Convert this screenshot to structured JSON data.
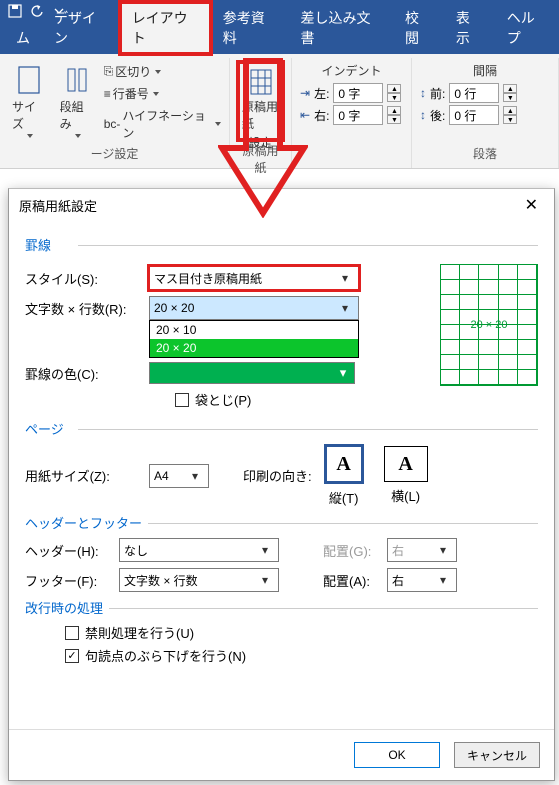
{
  "titlebar": {
    "save_icon": "💾",
    "undo_icon": "↺",
    "redo_icon": "↻"
  },
  "tabs": [
    "ム",
    "デザイン",
    "レイアウト",
    "参考資料",
    "差し込み文書",
    "校閲",
    "表示",
    "ヘルプ"
  ],
  "active_tab_index": 2,
  "ribbon": {
    "page_setup": {
      "label": "ージ設定",
      "size": "サイズ",
      "cols": "段組み",
      "breaks": "区切り",
      "line_no": "行番号",
      "hyphen": "ハイフネーション"
    },
    "genkou": {
      "btn_line1": "原稿用紙",
      "btn_line2": "設定",
      "group": "原稿用紙"
    },
    "indent": {
      "title": "インデント",
      "left_lbl": "左:",
      "right_lbl": "右:",
      "left_val": "0 字",
      "right_val": "0 字"
    },
    "spacing": {
      "title": "間隔",
      "before_lbl": "前:",
      "after_lbl": "後:",
      "before_val": "0 行",
      "after_val": "0 行",
      "group": "段落"
    }
  },
  "dialog": {
    "title": "原稿用紙設定",
    "sections": {
      "grid": "罫線",
      "page": "ページ",
      "hf": "ヘッダーとフッター",
      "break": "改行時の処理"
    },
    "style_lbl": "スタイル(S):",
    "style_val": "マス目付き原稿用紙",
    "size_lbl": "文字数 × 行数(R):",
    "size_sel": "20 × 20",
    "size_opts": [
      "20 × 10",
      "20 × 20"
    ],
    "color_lbl": "罫線の色(C):",
    "fold_lbl": "袋とじ(P)",
    "preview_lbl": "20 × 20",
    "paper_lbl": "用紙サイズ(Z):",
    "paper_val": "A4",
    "orient_lbl": "印刷の向き:",
    "orient_port": "縦(T)",
    "orient_land": "横(L)",
    "header_lbl": "ヘッダー(H):",
    "header_val": "なし",
    "footer_lbl": "フッター(F):",
    "footer_val": "文字数 × 行数",
    "align_lbl": "配置(G):",
    "align2_lbl": "配置(A):",
    "align_val": "右",
    "kinsoku": "禁則処理を行う(U)",
    "hanging": "句読点のぶら下げを行う(N)",
    "ok": "OK",
    "cancel": "キャンセル"
  },
  "colors": {
    "accent": "#2b579a",
    "highlight": "#e02020",
    "green": "#009933",
    "link": "#0066cc"
  }
}
